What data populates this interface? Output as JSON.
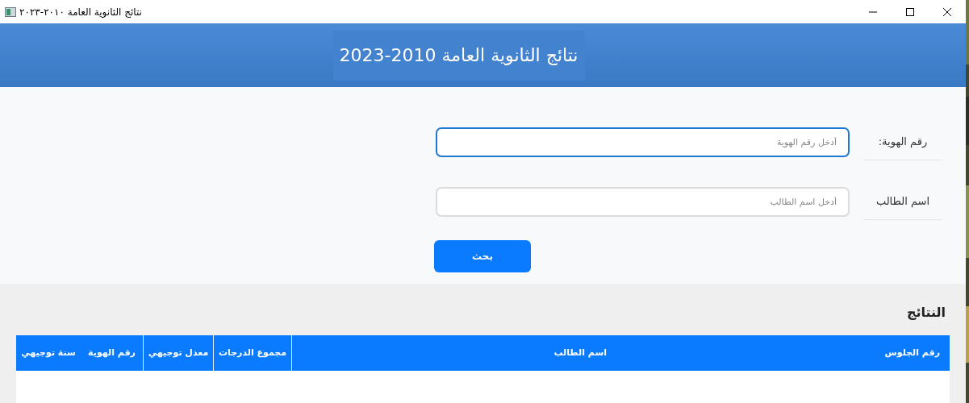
{
  "window": {
    "title": "نتائج الثانوية العامة ٢٠١٠-٢٠٢٣"
  },
  "header": {
    "title": "نتائج الثانوية العامة 2010-2023"
  },
  "form": {
    "fields": [
      {
        "label": "رقم الهوية:",
        "placeholder": "أدخل رقم الهوية",
        "focused": true
      },
      {
        "label": "اسم الطالب",
        "placeholder": "أدخل اسم الطالب",
        "focused": false
      }
    ],
    "button": "بحث"
  },
  "results": {
    "title": "النتائج",
    "table": {
      "columns": [
        "رقم الجلوس",
        "اسم الطالب",
        "مجموع الدرجات",
        "معدل توجيهي",
        "رقم الهوية",
        "سنة توجيهي"
      ]
    }
  }
}
